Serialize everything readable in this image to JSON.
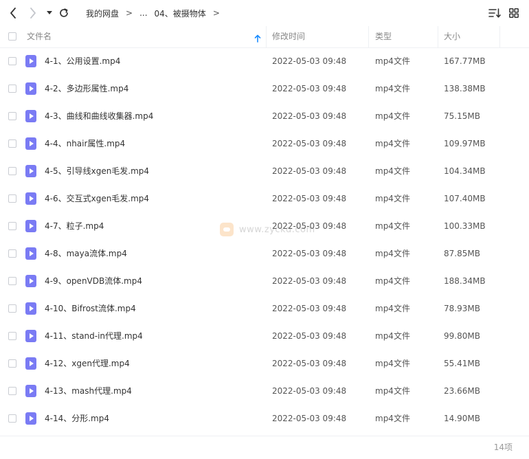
{
  "toolbar": {
    "breadcrumb": [
      "我的网盘",
      "...",
      "04、被摄物体"
    ],
    "separator": ">"
  },
  "table": {
    "columns": {
      "name": "文件名",
      "modified": "修改时间",
      "type": "类型",
      "size": "大小"
    },
    "rows": [
      {
        "name": "4-1、公用设置.mp4",
        "modified": "2022-05-03 09:48",
        "type": "mp4文件",
        "size": "167.77MB"
      },
      {
        "name": "4-2、多边形属性.mp4",
        "modified": "2022-05-03 09:48",
        "type": "mp4文件",
        "size": "138.38MB"
      },
      {
        "name": "4-3、曲线和曲线收集器.mp4",
        "modified": "2022-05-03 09:48",
        "type": "mp4文件",
        "size": "75.15MB"
      },
      {
        "name": "4-4、nhair属性.mp4",
        "modified": "2022-05-03 09:48",
        "type": "mp4文件",
        "size": "109.97MB"
      },
      {
        "name": "4-5、引导线xgen毛发.mp4",
        "modified": "2022-05-03 09:48",
        "type": "mp4文件",
        "size": "104.34MB"
      },
      {
        "name": "4-6、交互式xgen毛发.mp4",
        "modified": "2022-05-03 09:48",
        "type": "mp4文件",
        "size": "107.40MB"
      },
      {
        "name": "4-7、粒子.mp4",
        "modified": "2022-05-03 09:48",
        "type": "mp4文件",
        "size": "100.33MB"
      },
      {
        "name": "4-8、maya流体.mp4",
        "modified": "2022-05-03 09:48",
        "type": "mp4文件",
        "size": "87.85MB"
      },
      {
        "name": "4-9、openVDB流体.mp4",
        "modified": "2022-05-03 09:48",
        "type": "mp4文件",
        "size": "188.34MB"
      },
      {
        "name": "4-10、Bifrost流体.mp4",
        "modified": "2022-05-03 09:48",
        "type": "mp4文件",
        "size": "78.93MB"
      },
      {
        "name": "4-11、stand-in代理.mp4",
        "modified": "2022-05-03 09:48",
        "type": "mp4文件",
        "size": "99.80MB"
      },
      {
        "name": "4-12、xgen代理.mp4",
        "modified": "2022-05-03 09:48",
        "type": "mp4文件",
        "size": "55.41MB"
      },
      {
        "name": "4-13、mash代理.mp4",
        "modified": "2022-05-03 09:48",
        "type": "mp4文件",
        "size": "23.66MB"
      },
      {
        "name": "4-14、分形.mp4",
        "modified": "2022-05-03 09:48",
        "type": "mp4文件",
        "size": "14.90MB"
      }
    ]
  },
  "watermark": {
    "text": "www.zyckd.com"
  },
  "footer": {
    "count": "14项"
  },
  "colors": {
    "accent": "#1a8cff",
    "file_icon": "#7a7bf4",
    "border": "#eef0f3"
  },
  "icons": {
    "back": "chevron-left-icon",
    "forward": "chevron-right-icon",
    "history": "caret-down-icon",
    "refresh": "refresh-icon",
    "sort": "sort-list-icon",
    "grid": "grid-view-icon",
    "sort_indicator": "arrow-up-icon",
    "file": "video-file-icon"
  }
}
